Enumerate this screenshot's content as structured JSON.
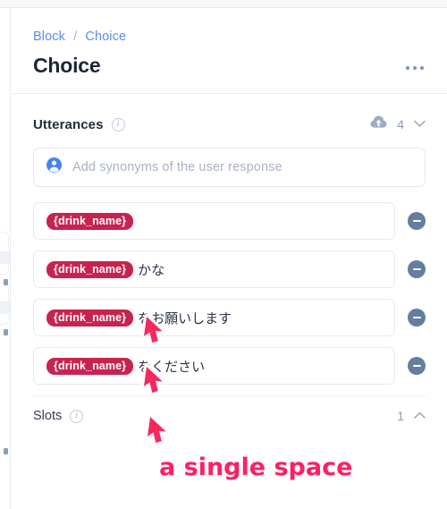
{
  "header": {
    "breadcrumb": {
      "root_label": "Block",
      "separator": "/",
      "current_label": "Choice"
    },
    "title": "Choice",
    "menu_icon": "kebab-menu-icon"
  },
  "utterances_section": {
    "title": "Utterances",
    "info_icon": "info-icon",
    "upload_icon": "cloud-upload-icon",
    "count": "4",
    "collapse_icon": "chevron-down-icon"
  },
  "synonym_input": {
    "icon": "user-avatar-icon",
    "placeholder": "Add synonyms of the user response",
    "value": ""
  },
  "utterances": [
    {
      "slot": "{drink_name}",
      "text": "",
      "remove_icon": "minus-circle-icon"
    },
    {
      "slot": "{drink_name}",
      "text": "かな",
      "remove_icon": "minus-circle-icon"
    },
    {
      "slot": "{drink_name}",
      "text": "をお願いします",
      "remove_icon": "minus-circle-icon"
    },
    {
      "slot": "{drink_name}",
      "text": "をください",
      "remove_icon": "minus-circle-icon"
    }
  ],
  "slots_section": {
    "title": "Slots",
    "info_icon": "info-icon",
    "count": "1",
    "collapse_icon": "chevron-up-icon"
  },
  "annotation": {
    "text": "a single space",
    "color": "#ff1f63",
    "arrow_icon": "arrow-pointer-icon",
    "arrow_count": "3"
  },
  "colors": {
    "link": "#5b8def",
    "slot_tag_bg": "#c8234f",
    "remove_btn_bg": "#647e9e",
    "annotation_pink": "#ff1f63",
    "title": "#1d2538"
  }
}
